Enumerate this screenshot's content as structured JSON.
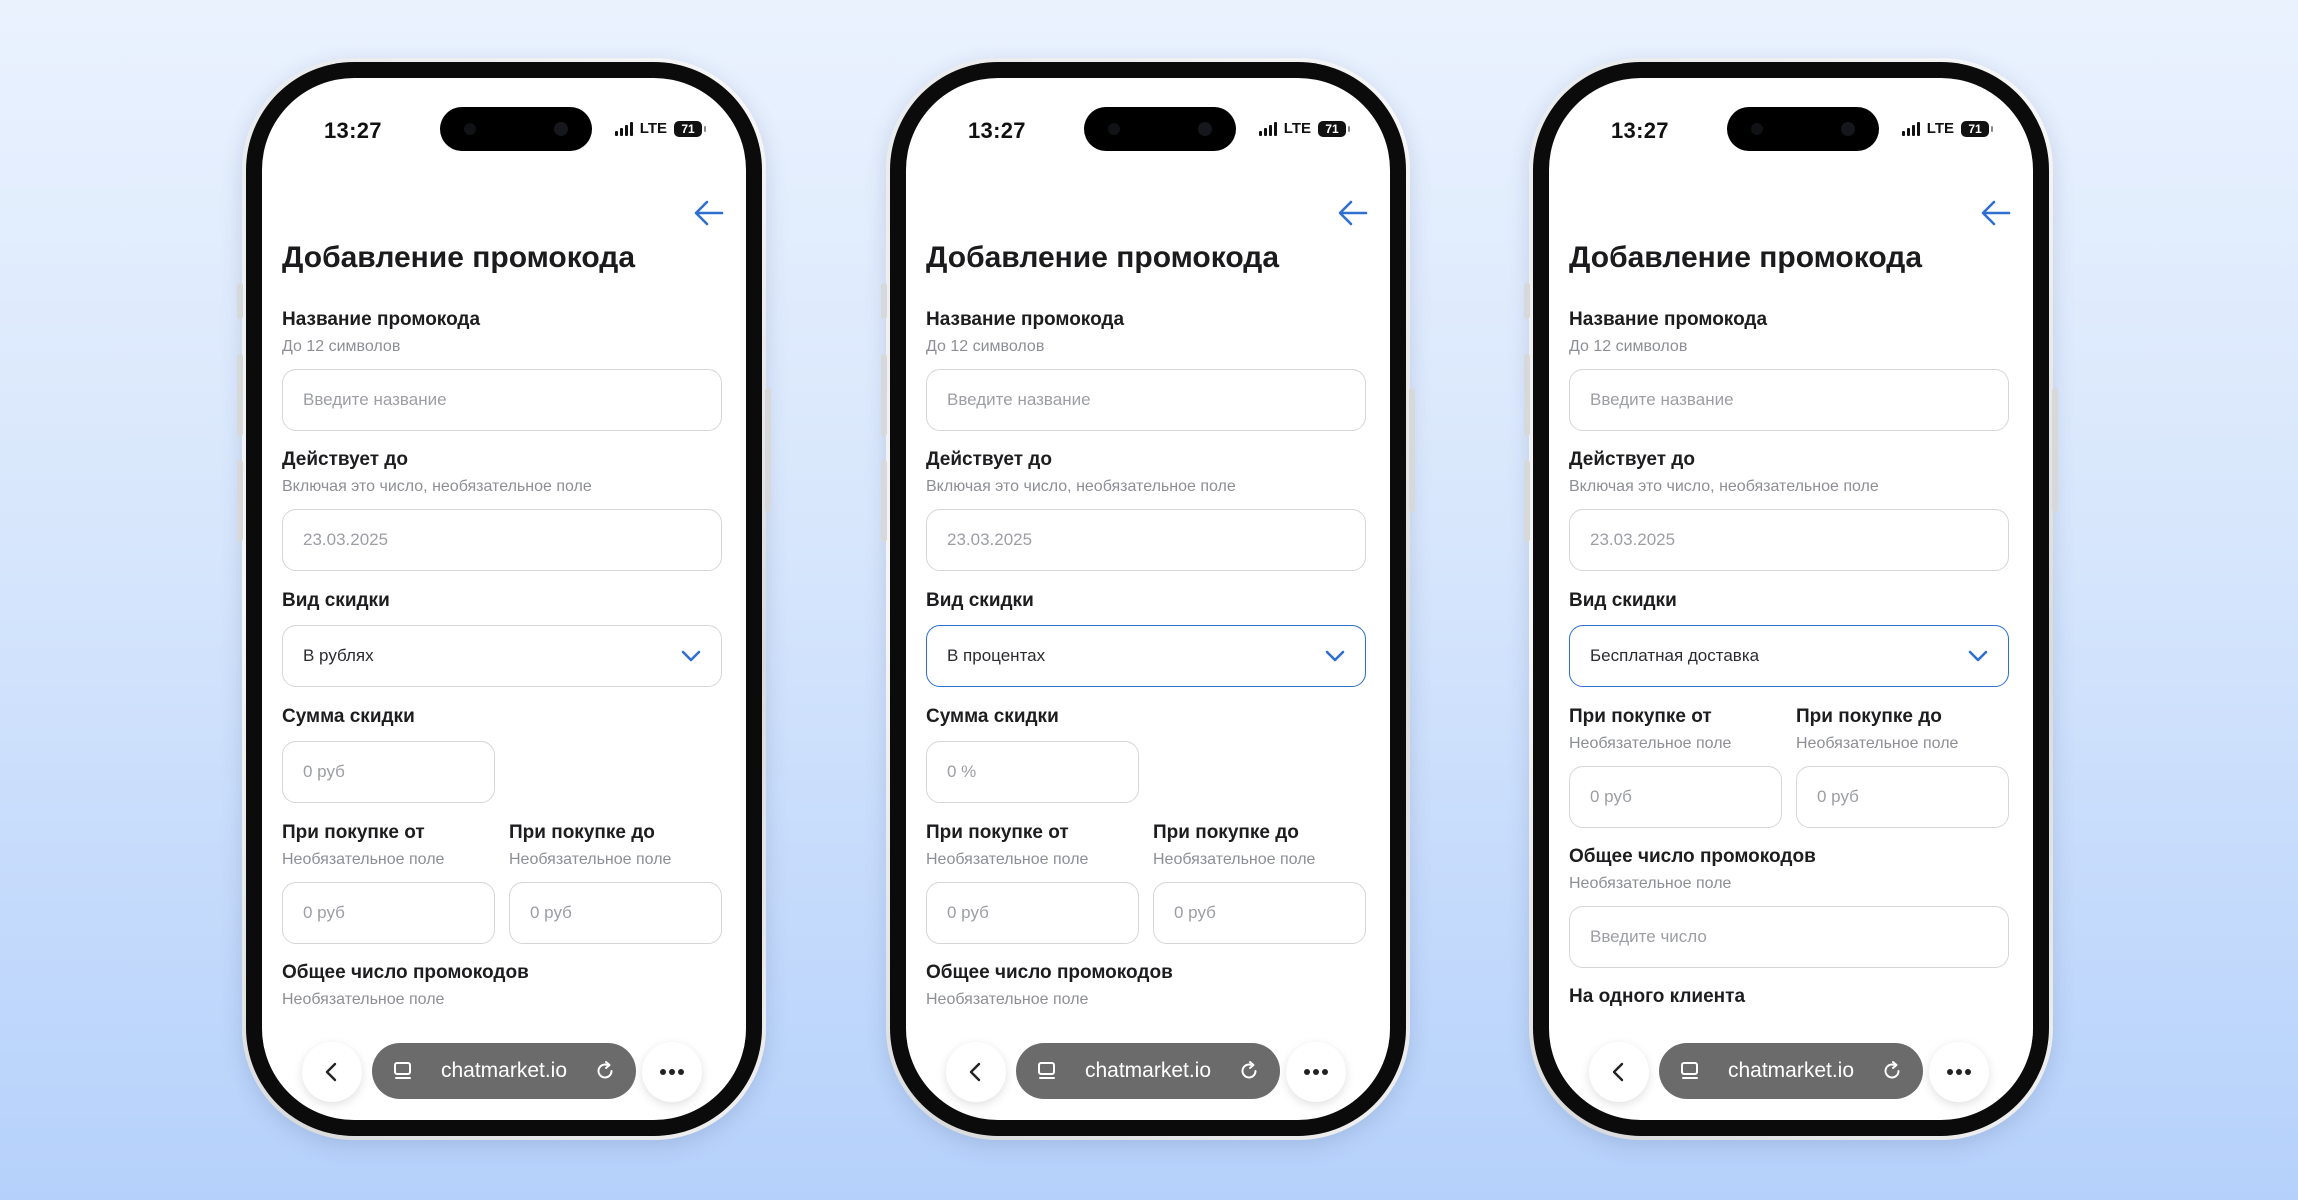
{
  "phones": [
    {
      "status": {
        "time": "13:27",
        "network": "LTE",
        "battery": "71"
      },
      "title": "Добавление промокода",
      "name_field": {
        "label": "Название промокода",
        "hint": "До 12 символов",
        "placeholder": "Введите название"
      },
      "valid_until": {
        "label": "Действует до",
        "hint": "Включая это число, необязательное поле",
        "value": "23.03.2025"
      },
      "discount_type": {
        "label": "Вид скидки",
        "selected": "В рублях"
      },
      "discount_amount": {
        "label": "Сумма скидки",
        "placeholder": "0 руб"
      },
      "purchase_from": {
        "label": "При покупке от",
        "hint": "Необязательное поле",
        "placeholder": "0 руб"
      },
      "purchase_to": {
        "label": "При покупке до",
        "hint": "Необязательное поле",
        "placeholder": "0 руб"
      },
      "total_count": {
        "label": "Общее число промокодов",
        "hint": "Необязательное поле"
      },
      "browser": {
        "url": "chatmarket.io"
      }
    },
    {
      "status": {
        "time": "13:27",
        "network": "LTE",
        "battery": "71"
      },
      "title": "Добавление промокода",
      "name_field": {
        "label": "Название промокода",
        "hint": "До 12 символов",
        "placeholder": "Введите название"
      },
      "valid_until": {
        "label": "Действует до",
        "hint": "Включая это число, необязательное поле",
        "value": "23.03.2025"
      },
      "discount_type": {
        "label": "Вид скидки",
        "selected": "В процентах"
      },
      "discount_amount": {
        "label": "Сумма скидки",
        "placeholder": "0 %"
      },
      "purchase_from": {
        "label": "При покупке от",
        "hint": "Необязательное поле",
        "placeholder": "0 руб"
      },
      "purchase_to": {
        "label": "При покупке до",
        "hint": "Необязательное поле",
        "placeholder": "0 руб"
      },
      "total_count": {
        "label": "Общее число промокодов",
        "hint": "Необязательное поле"
      },
      "browser": {
        "url": "chatmarket.io"
      }
    },
    {
      "status": {
        "time": "13:27",
        "network": "LTE",
        "battery": "71"
      },
      "title": "Добавление промокода",
      "name_field": {
        "label": "Название промокода",
        "hint": "До 12 символов",
        "placeholder": "Введите название"
      },
      "valid_until": {
        "label": "Действует до",
        "hint": "Включая это число, необязательное поле",
        "value": "23.03.2025"
      },
      "discount_type": {
        "label": "Вид скидки",
        "selected": "Бесплатная доставка"
      },
      "purchase_from": {
        "label": "При покупке от",
        "hint": "Необязательное поле",
        "placeholder": "0 руб"
      },
      "purchase_to": {
        "label": "При покупке до",
        "hint": "Необязательное поле",
        "placeholder": "0 руб"
      },
      "total_count": {
        "label": "Общее число промокодов",
        "hint": "Необязательное поле",
        "placeholder": "Введите число"
      },
      "per_client": {
        "label": "На одного клиента"
      },
      "browser": {
        "url": "chatmarket.io"
      }
    }
  ],
  "colors": {
    "accent": "#2f6fd0",
    "background_top": "#eaf2fe",
    "background_bottom": "#b5d1fb"
  },
  "icons": [
    "back-arrow-icon",
    "chevron-down-icon",
    "browser-back-icon",
    "tabs-icon",
    "reload-icon",
    "more-icon"
  ]
}
